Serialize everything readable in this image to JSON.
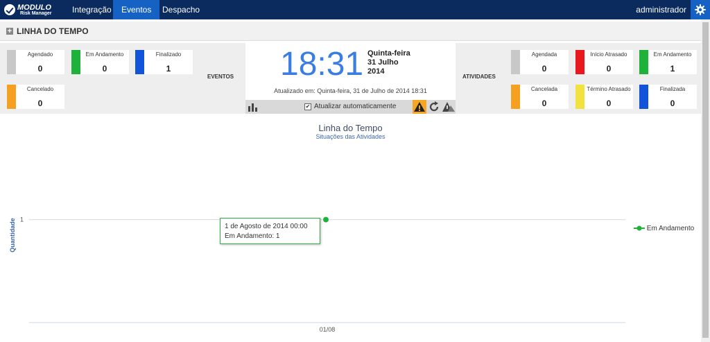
{
  "brand": {
    "line1": "MODULO",
    "line2": "Risk Manager"
  },
  "nav": [
    {
      "label": "Integração",
      "active": false
    },
    {
      "label": "Eventos",
      "active": true
    },
    {
      "label": "Despacho",
      "active": false
    }
  ],
  "user": {
    "name": "administrador"
  },
  "page": {
    "title": "LINHA DO TEMPO",
    "expand_symbol": "+"
  },
  "eventos": {
    "section_label": "EVENTOS",
    "cards": [
      {
        "label": "Agendado",
        "value": "0",
        "color": "#c8c8c8"
      },
      {
        "label": "Em Andamento",
        "value": "0",
        "color": "#1fb23b"
      },
      {
        "label": "Finalizado",
        "value": "1",
        "color": "#1254d9"
      },
      {
        "label": "Cancelado",
        "value": "0",
        "color": "#f5a021"
      }
    ]
  },
  "clock": {
    "time": "18:31",
    "weekday": "Quinta-feira",
    "date": "31 Julho",
    "year": "2014",
    "updated": "Atualizado em: Quinta-feira, 31 de Julho de 2014 18:31",
    "auto_update_label": "Atualizar automaticamente",
    "auto_update_checked": true,
    "check_mark": "✔",
    "icons": [
      "bar-chart-icon",
      "warning-icon",
      "refresh-icon",
      "alert-road-icon"
    ]
  },
  "atividades": {
    "section_label": "ATIVIDADES",
    "cards": [
      {
        "label": "Agendada",
        "value": "0",
        "color": "#c8c8c8"
      },
      {
        "label": "Início Atrasado",
        "value": "0",
        "color": "#e8181e"
      },
      {
        "label": "Em Andamento",
        "value": "1",
        "color": "#1fb23b"
      },
      {
        "label": "Cancelada",
        "value": "0",
        "color": "#f5a021"
      },
      {
        "label": "Término Atrasado",
        "value": "0",
        "color": "#f1e23f"
      },
      {
        "label": "Finalizada",
        "value": "0",
        "color": "#1254d9"
      }
    ]
  },
  "chart_data": {
    "type": "line",
    "title": "Linha do Tempo",
    "subtitle": "Situações das Atividades",
    "ylabel": "Quantidade",
    "xlabel": "",
    "x": [
      "01/08"
    ],
    "yticks": [
      1
    ],
    "ylim": [
      0,
      1.9
    ],
    "series": [
      {
        "name": "Em Andamento",
        "color": "#1fb23b",
        "points": [
          {
            "x": "01/08",
            "y": 1
          }
        ]
      }
    ],
    "tooltip": {
      "line1": "1 de Agosto de 2014 00:00",
      "line2": "Em Andamento: 1"
    },
    "legend_position": "right"
  }
}
